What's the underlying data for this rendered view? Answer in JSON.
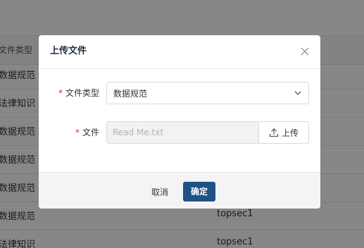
{
  "background_table": {
    "header_col1": "文件类型",
    "rows": [
      {
        "type": "数据规范",
        "owner": ""
      },
      {
        "type": "法律知识",
        "owner": ""
      },
      {
        "type": "数据规范",
        "owner": ""
      },
      {
        "type": "数据规范",
        "owner": ""
      },
      {
        "type": "数据规范",
        "owner": ""
      },
      {
        "type": "数据规范",
        "owner": "topsec1"
      },
      {
        "type": "法律知识",
        "owner": "topsec1"
      }
    ]
  },
  "dialog": {
    "title": "上传文件",
    "close_icon": "close-icon",
    "file_type": {
      "required_mark": "*",
      "label": "文件类型",
      "selected": "数据规范",
      "arrow_icon": "chevron-down-icon"
    },
    "file": {
      "required_mark": "*",
      "label": "文件",
      "value": "Read Me.txt",
      "upload_icon": "upload-icon",
      "upload_label": "上传"
    },
    "footer": {
      "cancel_label": "取消",
      "ok_label": "确定"
    }
  },
  "colors": {
    "primary": "#1f5283",
    "required": "#c0392b",
    "overlay": "rgba(0,0,0,0.47)"
  }
}
